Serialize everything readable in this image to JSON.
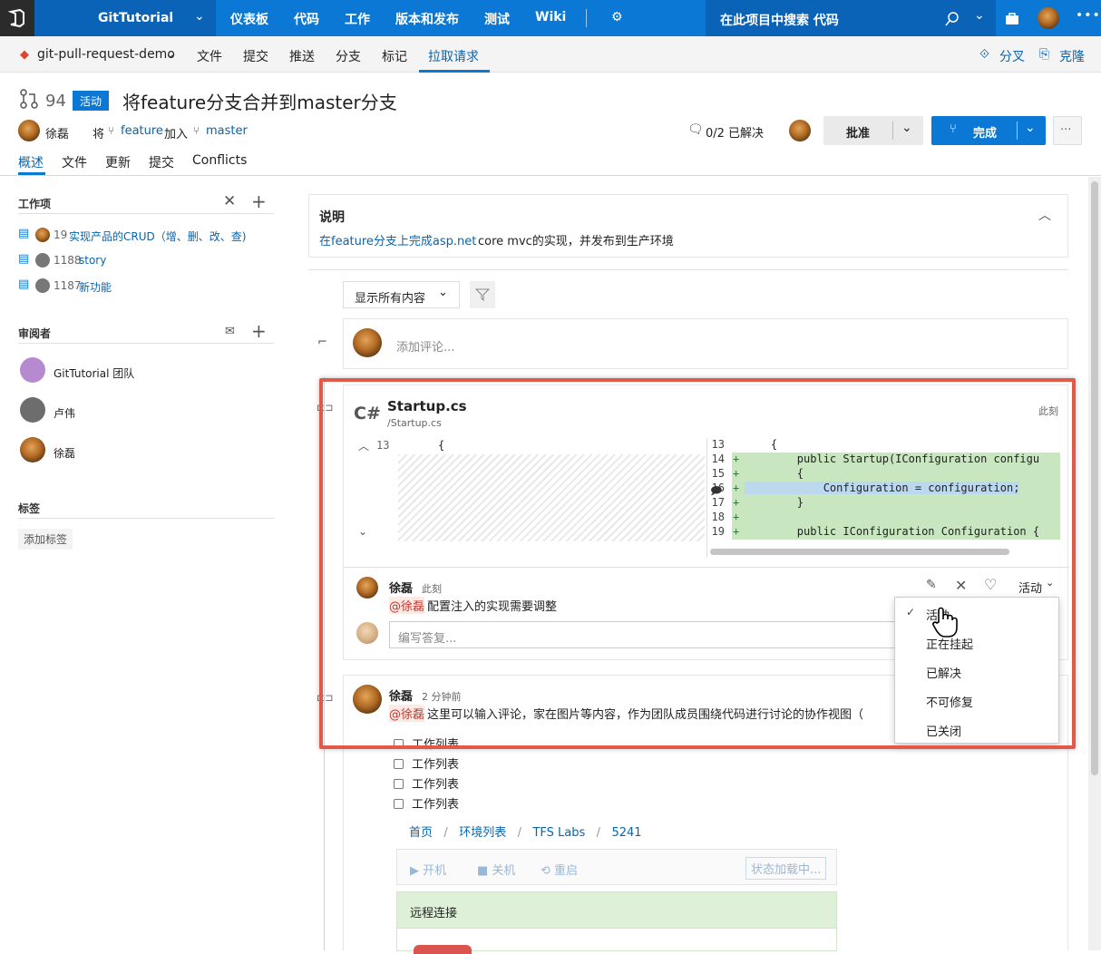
{
  "topbar": {
    "project": "GitTutorial",
    "nav": [
      "仪表板",
      "代码",
      "工作",
      "版本和发布",
      "测试",
      "Wiki"
    ],
    "search_placeholder": "在此项目中搜索 代码"
  },
  "subnav": {
    "repo": "git-pull-request-demo",
    "items": [
      "文件",
      "提交",
      "推送",
      "分支",
      "标记",
      "拉取请求"
    ],
    "fork": "分叉",
    "clone": "克隆"
  },
  "pr": {
    "id": "94",
    "status": "活动",
    "title": "将feature分支合并到master分支",
    "author": "徐磊",
    "merge_prefix": "将",
    "source": "feature",
    "merge_mid": "加入",
    "target": "master",
    "resolved": "0/2 已解决",
    "approve": "批准",
    "complete": "完成",
    "tabs": [
      "概述",
      "文件",
      "更新",
      "提交",
      "Conflicts"
    ]
  },
  "sidebar": {
    "workitems_title": "工作项",
    "workitems": [
      {
        "id": "19",
        "title": "实现产品的CRUD（增、删、改、查)"
      },
      {
        "id": "1188",
        "title": "story"
      },
      {
        "id": "1187",
        "title": "新功能"
      }
    ],
    "reviewers_title": "审阅者",
    "reviewers": [
      "GitTutorial 团队",
      "卢伟",
      "徐磊"
    ],
    "tags_title": "标签",
    "add_tag": "添加标签"
  },
  "description": {
    "title": "说明",
    "link": "在feature分支上完成asp.net",
    "text": " core mvc的实现，并发布到生产环境"
  },
  "filter": {
    "label": "显示所有内容"
  },
  "comment_input": {
    "placeholder": "添加评论..."
  },
  "file": {
    "lang": "C#",
    "name": "Startup.cs",
    "path": "/Startup.cs",
    "time": "此刻",
    "left_line": "13",
    "left_code": "{",
    "right_lines": [
      {
        "n": "13",
        "mark": "",
        "code": "    {"
      },
      {
        "n": "14",
        "mark": "+",
        "code": "        public Startup(IConfiguration configu"
      },
      {
        "n": "15",
        "mark": "+",
        "code": "        {"
      },
      {
        "n": "16",
        "mark": "+",
        "code": "            Configuration = configuration;"
      },
      {
        "n": "17",
        "mark": "+",
        "code": "        }"
      },
      {
        "n": "18",
        "mark": "+",
        "code": ""
      },
      {
        "n": "19",
        "mark": "+",
        "code": "        public IConfiguration Configuration {"
      }
    ]
  },
  "thread1": {
    "author": "徐磊",
    "time": "此刻",
    "mention": "@徐磊",
    "text": " 配置注入的实现需要调整",
    "status": "活动",
    "reply_placeholder": "编写答复..."
  },
  "status_menu": [
    "活动",
    "正在挂起",
    "已解决",
    "不可修复",
    "已关闭"
  ],
  "thread2": {
    "author": "徐磊",
    "time": "2 分钟前",
    "mention": "@徐磊",
    "text": " 这里可以输入评论，家在图片等内容，作为团队成员围绕代码进行讨论的协作视图（",
    "checklist": [
      "工作列表",
      "工作列表",
      "工作列表",
      "工作列表"
    ],
    "breadcrumb": [
      "首页",
      "环境列表",
      "TFS Labs",
      "5241"
    ],
    "actions": [
      "开机",
      "关机",
      "重启"
    ],
    "status_btn": "状态加载中...",
    "remote": "远程连接"
  }
}
